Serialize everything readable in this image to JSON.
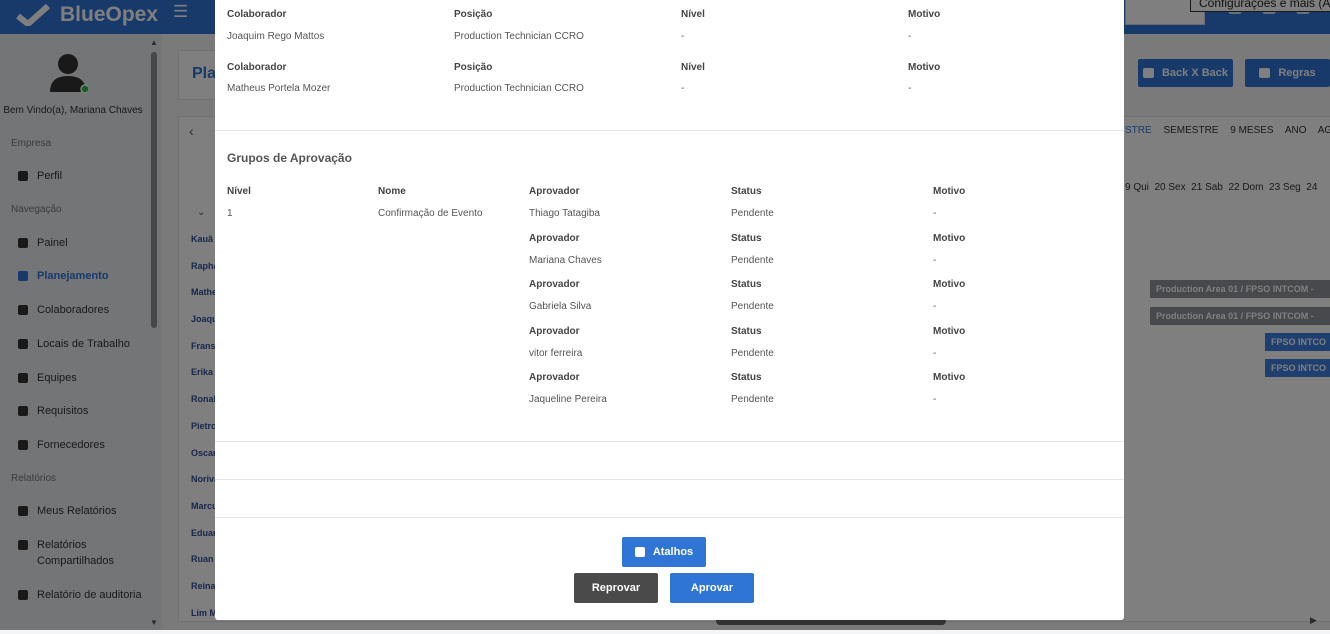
{
  "app": {
    "brand": "BlueOpex",
    "tooltip": "Configurações e mais (Al"
  },
  "sidebar": {
    "welcome": "Bem Vindo(a), Mariana Chaves",
    "sections": {
      "empresa": "Empresa",
      "navegacao": "Navegação",
      "relatorios": "Relatórios"
    },
    "items": [
      "Perfil",
      "Painel",
      "Planejamento",
      "Colaboradores",
      "Locais de Trabalho",
      "Equipes",
      "Requisitos",
      "Fornecedores",
      "Meus Relatórios",
      "Relatórios Compartilhados",
      "Relatório de auditoria"
    ]
  },
  "background": {
    "title": "Pla",
    "buttons": {
      "backxback": "Back X Back",
      "regras": "Regras"
    },
    "periods": [
      "STRE",
      "SEMESTRE",
      "9 MESES",
      "ANO",
      "AGENDA"
    ],
    "days": [
      "9 Qui",
      "20 Sex",
      "21 Sab",
      "22 Dom",
      "23 Seg",
      "24"
    ],
    "names": [
      "Kauã",
      "Rapha",
      "Mathe",
      "Joaqu",
      "Fransi",
      "Erika",
      "Ronal",
      "Pietro",
      "Oscar",
      "Norival",
      "Marcu",
      "Eduard",
      "Ruan",
      "Reinal",
      "Lim M"
    ],
    "bars": [
      "Production Area 01 / FPSO INTCOM -",
      "Production Area 01 / FPSO INTCOM -",
      "FPSO INTCO",
      "FPSO INTCO"
    ]
  },
  "modal": {
    "colaboradores": [
      {
        "label_colaborador": "Colaborador",
        "label_posicao": "Posição",
        "label_nivel": "Nível",
        "label_motivo": "Motivo",
        "colaborador": "Joaquim Rego Mattos",
        "posicao": "Production Technician CCRO",
        "nivel": "-",
        "motivo": "-"
      },
      {
        "label_colaborador": "Colaborador",
        "label_posicao": "Posição",
        "label_nivel": "Nível",
        "label_motivo": "Motivo",
        "colaborador": "Matheus Portela Mozer",
        "posicao": "Production Technician CCRO",
        "nivel": "-",
        "motivo": "-"
      }
    ],
    "grupos": {
      "title": "Grupos de Aprovação",
      "headers": {
        "nivel": "Nível",
        "nome": "Nome",
        "aprovador": "Aprovador",
        "status": "Status",
        "motivo": "Motivo"
      },
      "nivel": "1",
      "nome": "Confirmação de Evento",
      "aprovadores": [
        {
          "nome": "Thiago Tatagiba",
          "status": "Pendente",
          "motivo": "-"
        },
        {
          "nome": "Mariana Chaves",
          "status": "Pendente",
          "motivo": "-"
        },
        {
          "nome": "Gabriela Silva",
          "status": "Pendente",
          "motivo": "-"
        },
        {
          "nome": "vitor ferreira",
          "status": "Pendente",
          "motivo": "-"
        },
        {
          "nome": "Jaqueline Pereira",
          "status": "Pendente",
          "motivo": "-"
        }
      ]
    },
    "buttons": {
      "atalhos": "Atalhos",
      "reprovar": "Reprovar",
      "aprovar": "Aprovar"
    },
    "colors": {
      "primary": "#2f75d6",
      "dark": "#4a4a4a"
    }
  }
}
